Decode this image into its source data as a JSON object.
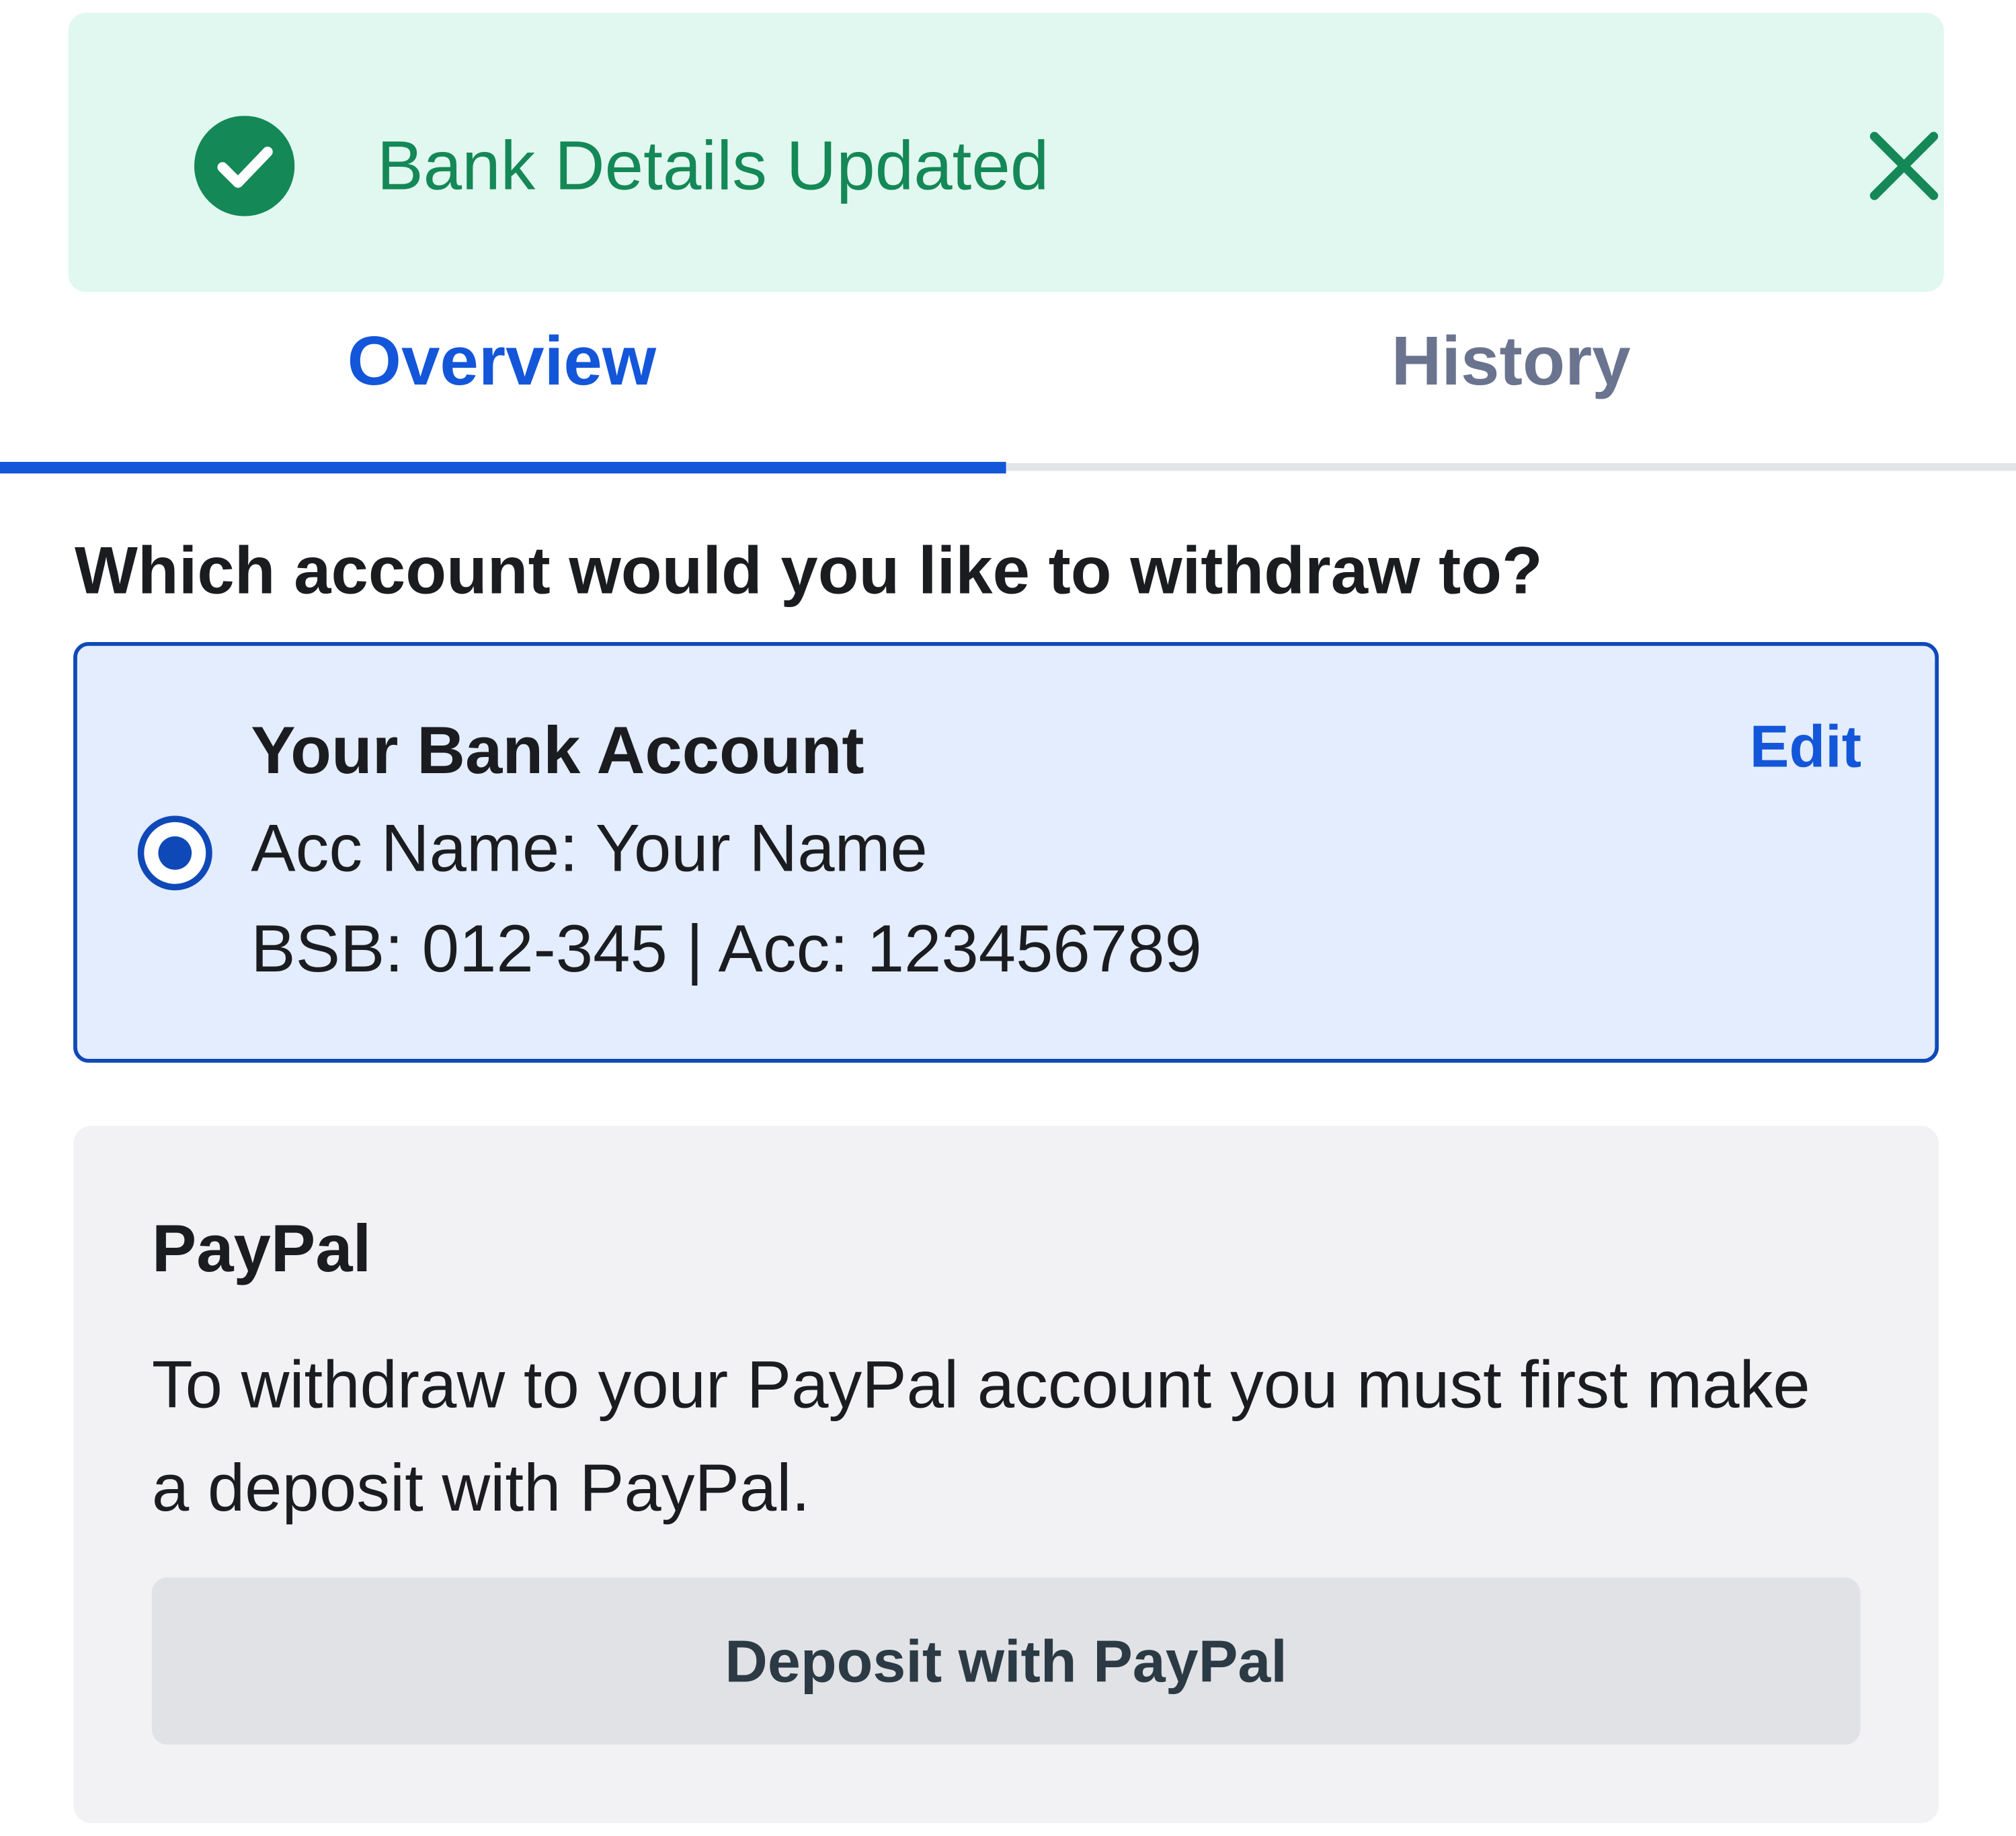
{
  "colors": {
    "success_bg": "#e1f8f0",
    "success_fg": "#148856",
    "accent": "#1356d9",
    "tab_inactive": "#6a748f",
    "selected_card_bg": "#e3edfd",
    "selected_card_border": "#0f49b8",
    "muted_card_bg": "#f2f2f4",
    "secondary_button_bg": "#e1e2e6"
  },
  "toast": {
    "icon": "check-circle-icon",
    "message": "Bank Details Updated",
    "close_icon": "close-icon"
  },
  "tabs": [
    {
      "label": "Overview",
      "active": true
    },
    {
      "label": "History",
      "active": false
    }
  ],
  "question": "Which account would you like to withdraw to?",
  "bank_account": {
    "title": "Your Bank Account",
    "acc_name_line": "Acc Name: Your Name",
    "numbers_line": "BSB: 012-345 | Acc: 123456789",
    "edit_label": "Edit",
    "selected": true
  },
  "paypal": {
    "title": "PayPal",
    "description": "To withdraw to your PayPal account you must first make a deposit with PayPal.",
    "button_label": "Deposit with PayPal"
  }
}
